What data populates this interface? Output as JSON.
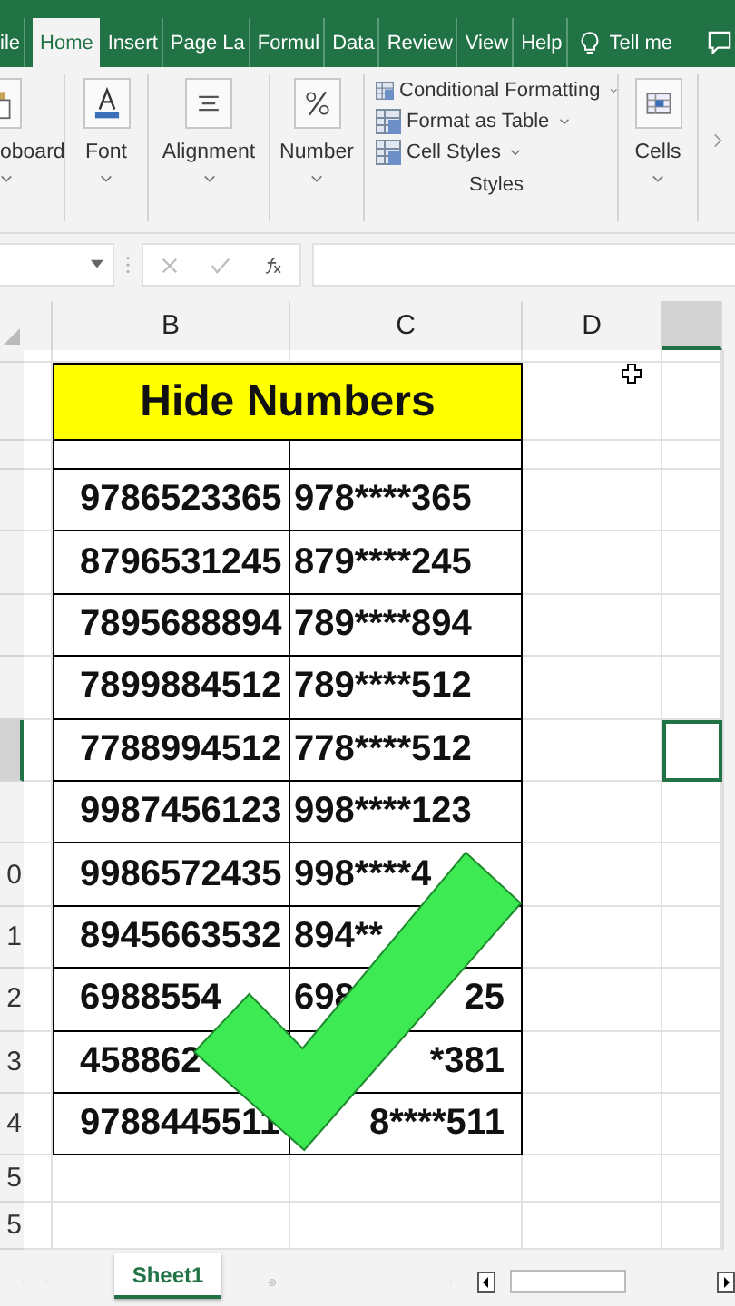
{
  "ribbon_tabs": [
    {
      "label": "ile",
      "selected": false
    },
    {
      "label": "Home",
      "selected": true
    },
    {
      "label": "Insert",
      "selected": false
    },
    {
      "label": "Page La",
      "selected": false
    },
    {
      "label": "Formul",
      "selected": false
    },
    {
      "label": "Data",
      "selected": false
    },
    {
      "label": "Review",
      "selected": false
    },
    {
      "label": "View",
      "selected": false
    },
    {
      "label": "Help",
      "selected": false
    }
  ],
  "tell_me": "Tell me",
  "ribbon_groups": [
    {
      "label": "oboard"
    },
    {
      "label": "Font"
    },
    {
      "label": "Alignment"
    },
    {
      "label": "Number"
    }
  ],
  "styles_group": {
    "items": [
      "Conditional Formatting",
      "Format as Table",
      "Cell Styles"
    ],
    "label": "Styles"
  },
  "cells_group": {
    "label": "Cells"
  },
  "columns": [
    "B",
    "C",
    "D"
  ],
  "title": "Hide Numbers",
  "rows": [
    {
      "b": "9786523365",
      "c": "978****365",
      "selected": false
    },
    {
      "b": "8796531245",
      "c": "879****245",
      "selected": false
    },
    {
      "b": "7895688894",
      "c": "789****894",
      "selected": false
    },
    {
      "b": "7899884512",
      "c": "789****512",
      "selected": false
    },
    {
      "b": "7788994512",
      "c": "778****512",
      "selected": true
    },
    {
      "b": "9987456123",
      "c": "998****123",
      "selected": false
    },
    {
      "header": "0",
      "b": "9986572435",
      "c": "998****4",
      "selected": false
    },
    {
      "header": "1",
      "b": "8945663532",
      "c": "894**",
      "selected": false
    },
    {
      "header": "2",
      "b": "6988554",
      "c": "698",
      "c_end": "25",
      "selected": false
    },
    {
      "header": "3",
      "b": "458862",
      "c_end": "*381",
      "selected": false
    },
    {
      "header": "4",
      "b": "9788445511",
      "c_end": "8****511",
      "selected": false
    }
  ],
  "empty_rows": [
    "5",
    "5"
  ],
  "sheet_tabs": [
    {
      "label": "Sheet1",
      "selected": true
    }
  ]
}
